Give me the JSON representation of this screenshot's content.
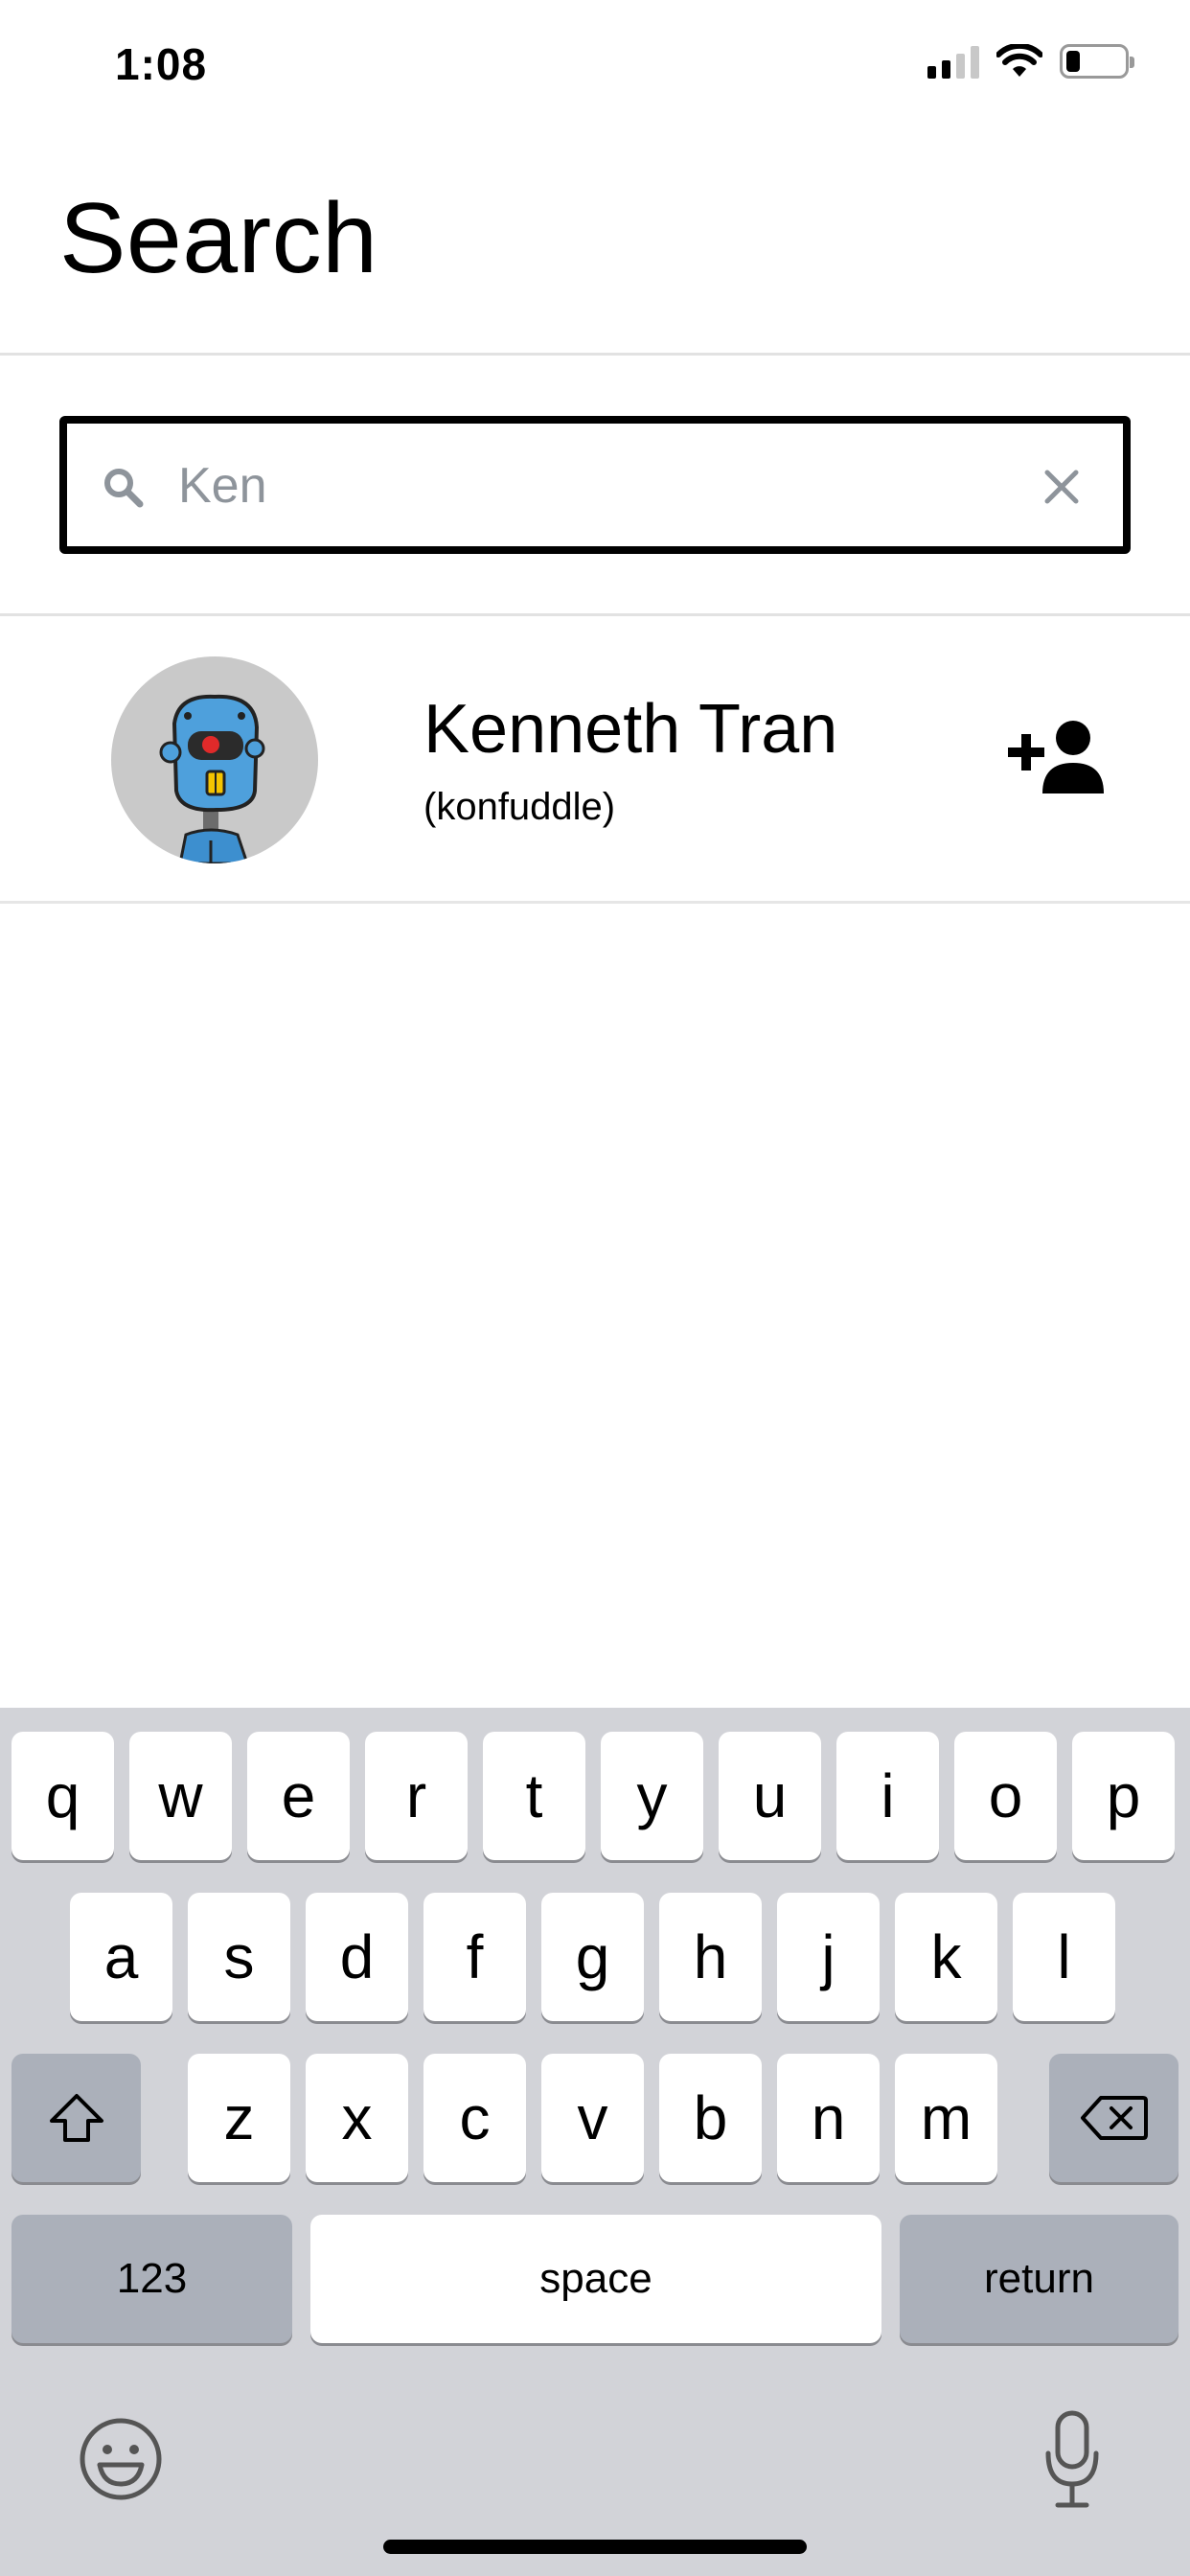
{
  "status_bar": {
    "time": "1:08"
  },
  "header": {
    "title": "Search"
  },
  "search": {
    "value": "Ken",
    "placeholder": "Ken"
  },
  "results": [
    {
      "name": "Kenneth Tran",
      "username": "(konfuddle)",
      "avatar": "robot-avatar",
      "action_icon": "add-friend-icon"
    }
  ],
  "keyboard": {
    "row1": [
      "q",
      "w",
      "e",
      "r",
      "t",
      "y",
      "u",
      "i",
      "o",
      "p"
    ],
    "row2": [
      "a",
      "s",
      "d",
      "f",
      "g",
      "h",
      "j",
      "k",
      "l"
    ],
    "row3": [
      "z",
      "x",
      "c",
      "v",
      "b",
      "n",
      "m"
    ],
    "numbers_label": "123",
    "space_label": "space",
    "return_label": "return"
  },
  "colors": {
    "keyboard_bg": "#d2d3d8",
    "dark_key": "#abb0ba",
    "placeholder": "#8e949b"
  }
}
